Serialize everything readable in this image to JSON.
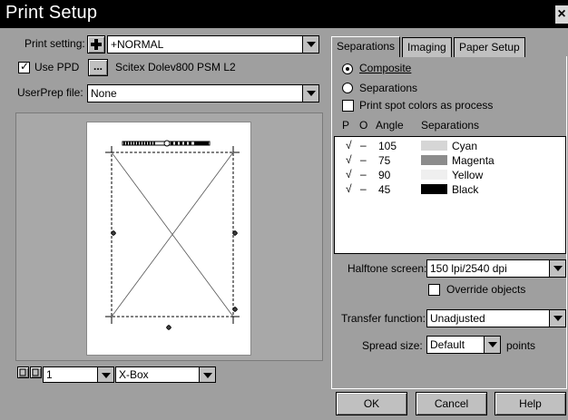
{
  "window": {
    "title": "Print Setup",
    "close_glyph": "×"
  },
  "left": {
    "print_setting": {
      "label": "Print setting:",
      "value": "+NORMAL"
    },
    "use_ppd": {
      "label": "Use PPD",
      "checked": true,
      "browse_label": "...",
      "ppd_name": "Scitex Dolev800 PSM L2"
    },
    "userprep": {
      "label": "UserPrep file:",
      "value": "None"
    },
    "bottom": {
      "page_value": "1",
      "view_value": "X-Box"
    }
  },
  "tabs": [
    {
      "label": "Separations",
      "active": true
    },
    {
      "label": "Imaging",
      "active": false
    },
    {
      "label": "Paper Setup",
      "active": false
    }
  ],
  "separations_tab": {
    "composite_label": "Composite",
    "separations_label": "Separations",
    "selected_mode": "composite",
    "spot_label": "Print spot colors as process",
    "spot_checked": false,
    "list_headers": {
      "p": "P",
      "o": "O",
      "angle": "Angle",
      "separations": "Separations"
    },
    "rows": [
      {
        "p": "√",
        "o": "–",
        "angle": "105",
        "name": "Cyan",
        "color": "#d6d6d6"
      },
      {
        "p": "√",
        "o": "–",
        "angle": "75",
        "name": "Magenta",
        "color": "#8c8c8c"
      },
      {
        "p": "√",
        "o": "–",
        "angle": "90",
        "name": "Yellow",
        "color": "#efefef"
      },
      {
        "p": "√",
        "o": "–",
        "angle": "45",
        "name": "Black",
        "color": "#000000"
      }
    ],
    "halftone": {
      "label": "Halftone screen:",
      "value": "150 lpi/2540 dpi"
    },
    "override": {
      "label": "Override objects",
      "checked": false
    },
    "transfer": {
      "label": "Transfer function:",
      "value": "Unadjusted"
    },
    "spread": {
      "label": "Spread size:",
      "value": "Default",
      "unit": "points"
    }
  },
  "buttons": {
    "ok": "OK",
    "cancel": "Cancel",
    "help": "Help"
  }
}
